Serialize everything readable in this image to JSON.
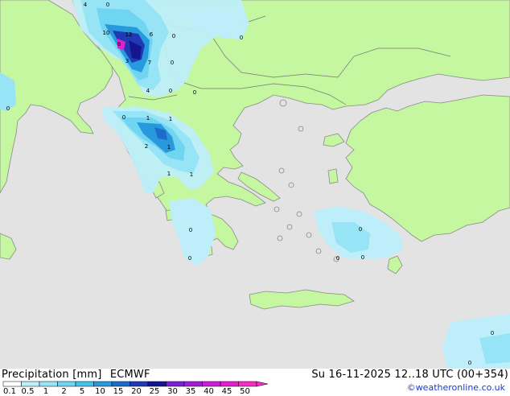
{
  "title": {
    "label": "Precipitation [mm]",
    "model": "ECMWF",
    "datetime": "Su 16-11-2025 12..18 UTC (00+354)"
  },
  "credit": "©weatheronline.co.uk",
  "legend": {
    "ticks": [
      "0.1",
      "0.5",
      "1",
      "2",
      "5",
      "10",
      "15",
      "20",
      "25",
      "30",
      "35",
      "40",
      "45",
      "50"
    ],
    "colors": [
      "#ffffff",
      "#bdeefa",
      "#97e4f6",
      "#6fd5f1",
      "#45c2ec",
      "#2799dc",
      "#1d6cc9",
      "#1f3ab2",
      "#14158f",
      "#7a1fd6",
      "#a21fd8",
      "#cc1fd8",
      "#e41fd0",
      "#f52fc4"
    ]
  },
  "colors": {
    "sea": "#e3e3e3",
    "land": "#c4f7a0",
    "coast": "#8a8a8a",
    "border": "#777777"
  },
  "map": {
    "value_labels": [
      "4",
      "0",
      "10",
      "12",
      "6",
      "0",
      "8",
      "3",
      "7",
      "0",
      "0",
      "4",
      "0",
      "0",
      "0",
      "1",
      "1",
      "1",
      "2",
      "1",
      "1",
      "0",
      "0",
      "0",
      "0",
      "0",
      "0",
      "0",
      "0"
    ]
  }
}
